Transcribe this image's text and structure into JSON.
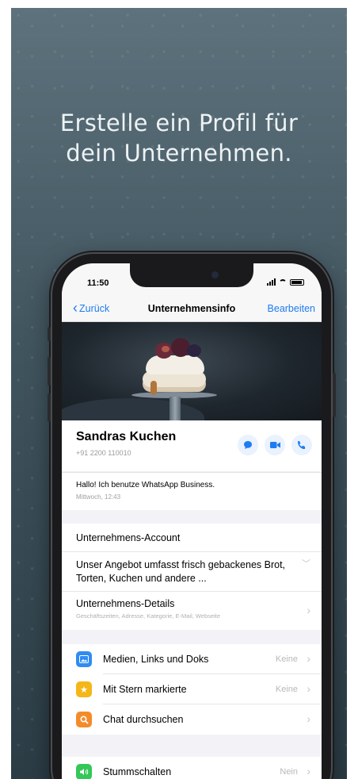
{
  "headline": {
    "line1": "Erstelle ein Profil für",
    "line2": "dein Unternehmen."
  },
  "status": {
    "time": "11:50"
  },
  "nav": {
    "back": "Zurück",
    "title": "Unternehmensinfo",
    "edit": "Bearbeiten"
  },
  "profile": {
    "name": "Sandras Kuchen",
    "phone": "+91 2200 110010"
  },
  "about": {
    "text": "Hallo! Ich benutze WhatsApp Business.",
    "date": "Mittwoch, 12:43"
  },
  "business": {
    "account_label": "Unternehmens-Account",
    "description": "Unser Angebot umfasst frisch gebackenes Brot, Torten, Kuchen und andere ...",
    "details_label": "Unternehmens-Details",
    "details_sub": "Geschäftszeiten, Adresse, Kategorie, E-Mail, Webseite"
  },
  "media": [
    {
      "label": "Medien, Links und Doks",
      "value": "Keine",
      "icon": "photo-icon",
      "color": "#2f8cf2"
    },
    {
      "label": "Mit Stern markierte",
      "value": "Keine",
      "icon": "star-icon",
      "color": "#f5b619"
    },
    {
      "label": "Chat durchsuchen",
      "value": "",
      "icon": "search-icon",
      "color": "#f48b2a"
    }
  ],
  "mute": {
    "label": "Stummschalten",
    "value": "Nein",
    "icon": "speaker-icon",
    "color": "#34c759"
  },
  "colors": {
    "accent": "#1e7cf2"
  }
}
